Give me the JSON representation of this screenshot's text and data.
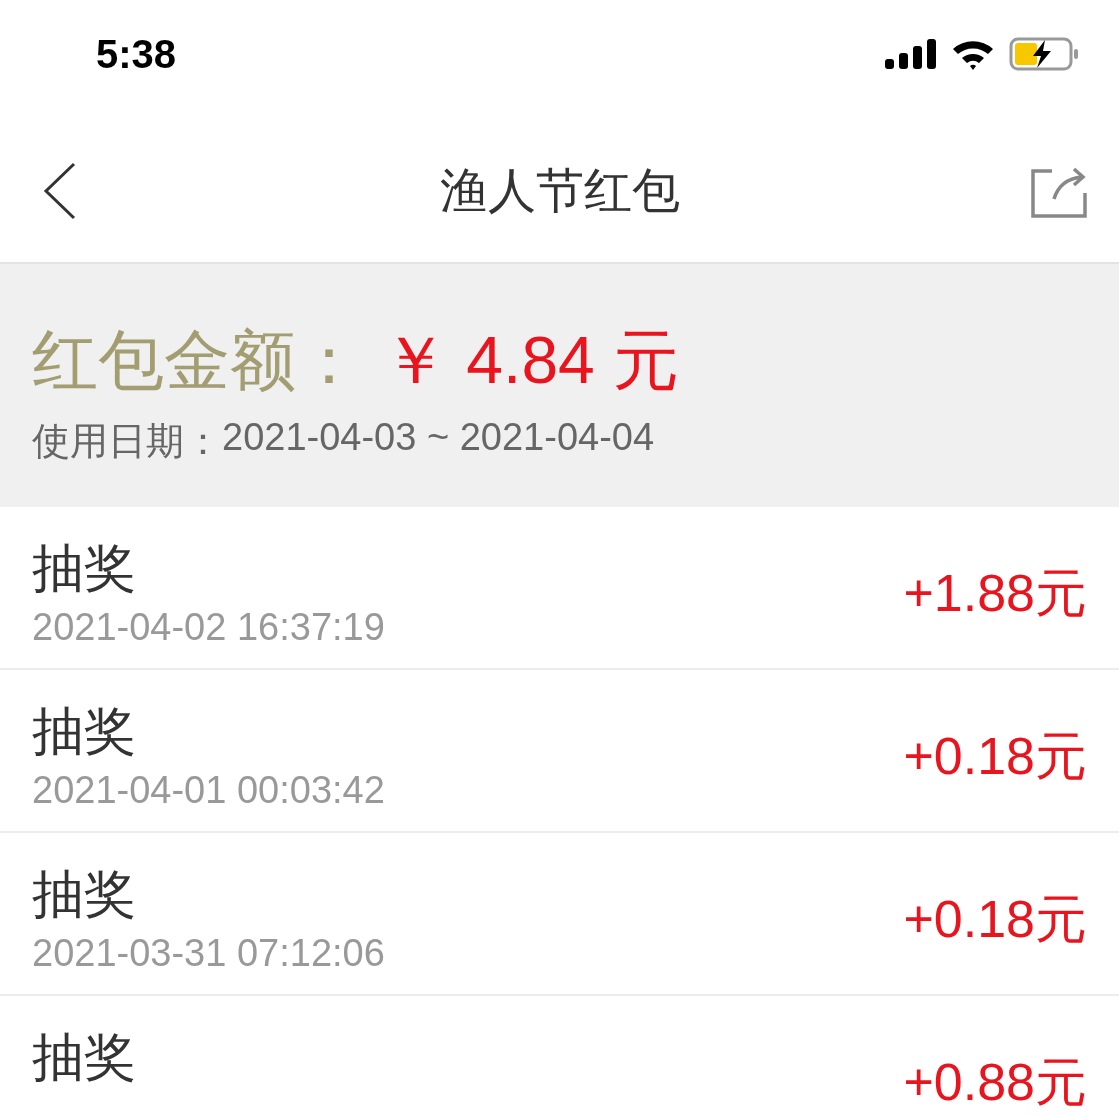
{
  "status_bar": {
    "time": "5:38"
  },
  "nav": {
    "title": "渔人节红包"
  },
  "summary": {
    "label": "红包金额：",
    "amount": "￥ 4.84 元",
    "date_label": "使用日期：",
    "date_range": "2021-04-03 ~ 2021-04-04"
  },
  "records": [
    {
      "title": "抽奖",
      "time": "2021-04-02 16:37:19",
      "amount": "+1.88元"
    },
    {
      "title": "抽奖",
      "time": "2021-04-01 00:03:42",
      "amount": "+0.18元"
    },
    {
      "title": "抽奖",
      "time": "2021-03-31 07:12:06",
      "amount": "+0.18元"
    },
    {
      "title": "抽奖",
      "amount": "+0.88元"
    }
  ]
}
